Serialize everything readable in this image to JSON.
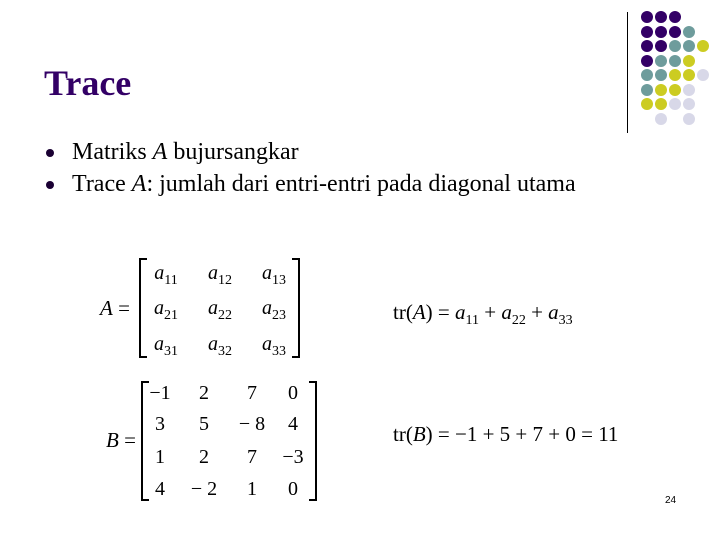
{
  "slide": {
    "title": "Trace",
    "bullets": [
      {
        "pre": "Matriks ",
        "var": "A",
        "post": " bujursangkar"
      },
      {
        "pre": "Trace ",
        "var": "A",
        "post": ": jumlah dari entri-entri pada diagonal utama"
      }
    ],
    "page_number": "24"
  },
  "matrix_a": {
    "name": "A",
    "equals": "=",
    "rows": [
      [
        {
          "base": "a",
          "sub": "11"
        },
        {
          "base": "a",
          "sub": "12"
        },
        {
          "base": "a",
          "sub": "13"
        }
      ],
      [
        {
          "base": "a",
          "sub": "21"
        },
        {
          "base": "a",
          "sub": "22"
        },
        {
          "base": "a",
          "sub": "23"
        }
      ],
      [
        {
          "base": "a",
          "sub": "31"
        },
        {
          "base": "a",
          "sub": "32"
        },
        {
          "base": "a",
          "sub": "33"
        }
      ]
    ],
    "trace_formula": {
      "lhs": "tr(",
      "var": "A",
      "rhs": ") = ",
      "terms": [
        {
          "base": "a",
          "sub": "11"
        },
        {
          "base": "a",
          "sub": "22"
        },
        {
          "base": "a",
          "sub": "33"
        }
      ],
      "op": " + "
    }
  },
  "matrix_b": {
    "name": "B",
    "equals": "=",
    "rows": [
      [
        "−1",
        "2",
        "7",
        "0"
      ],
      [
        "3",
        "5",
        "− 8",
        "4"
      ],
      [
        "1",
        "2",
        "7",
        "−3"
      ],
      [
        "4",
        "− 2",
        "1",
        "0"
      ]
    ],
    "trace_formula": {
      "lhs": "tr(",
      "var": "B",
      "rhs": ") = −1 + 5 + 7 + 0 = 11"
    }
  },
  "decoration": {
    "colors": {
      "purple": "#330066",
      "teal": "#6e9c9c",
      "yellow": "#cccc22",
      "lavender": "#d8d8e8"
    },
    "dot_grid": [
      [
        "purple",
        "purple",
        "purple",
        null,
        null
      ],
      [
        "purple",
        "purple",
        "purple",
        "teal",
        null
      ],
      [
        "purple",
        "purple",
        "teal",
        "teal",
        "yellow"
      ],
      [
        "purple",
        "teal",
        "teal",
        "yellow",
        null
      ],
      [
        "teal",
        "teal",
        "yellow",
        "yellow",
        "lavender"
      ],
      [
        "teal",
        "yellow",
        "yellow",
        "lavender",
        null
      ],
      [
        "yellow",
        "yellow",
        "lavender",
        "lavender",
        null
      ],
      [
        null,
        "lavender",
        null,
        "lavender",
        null
      ]
    ]
  }
}
